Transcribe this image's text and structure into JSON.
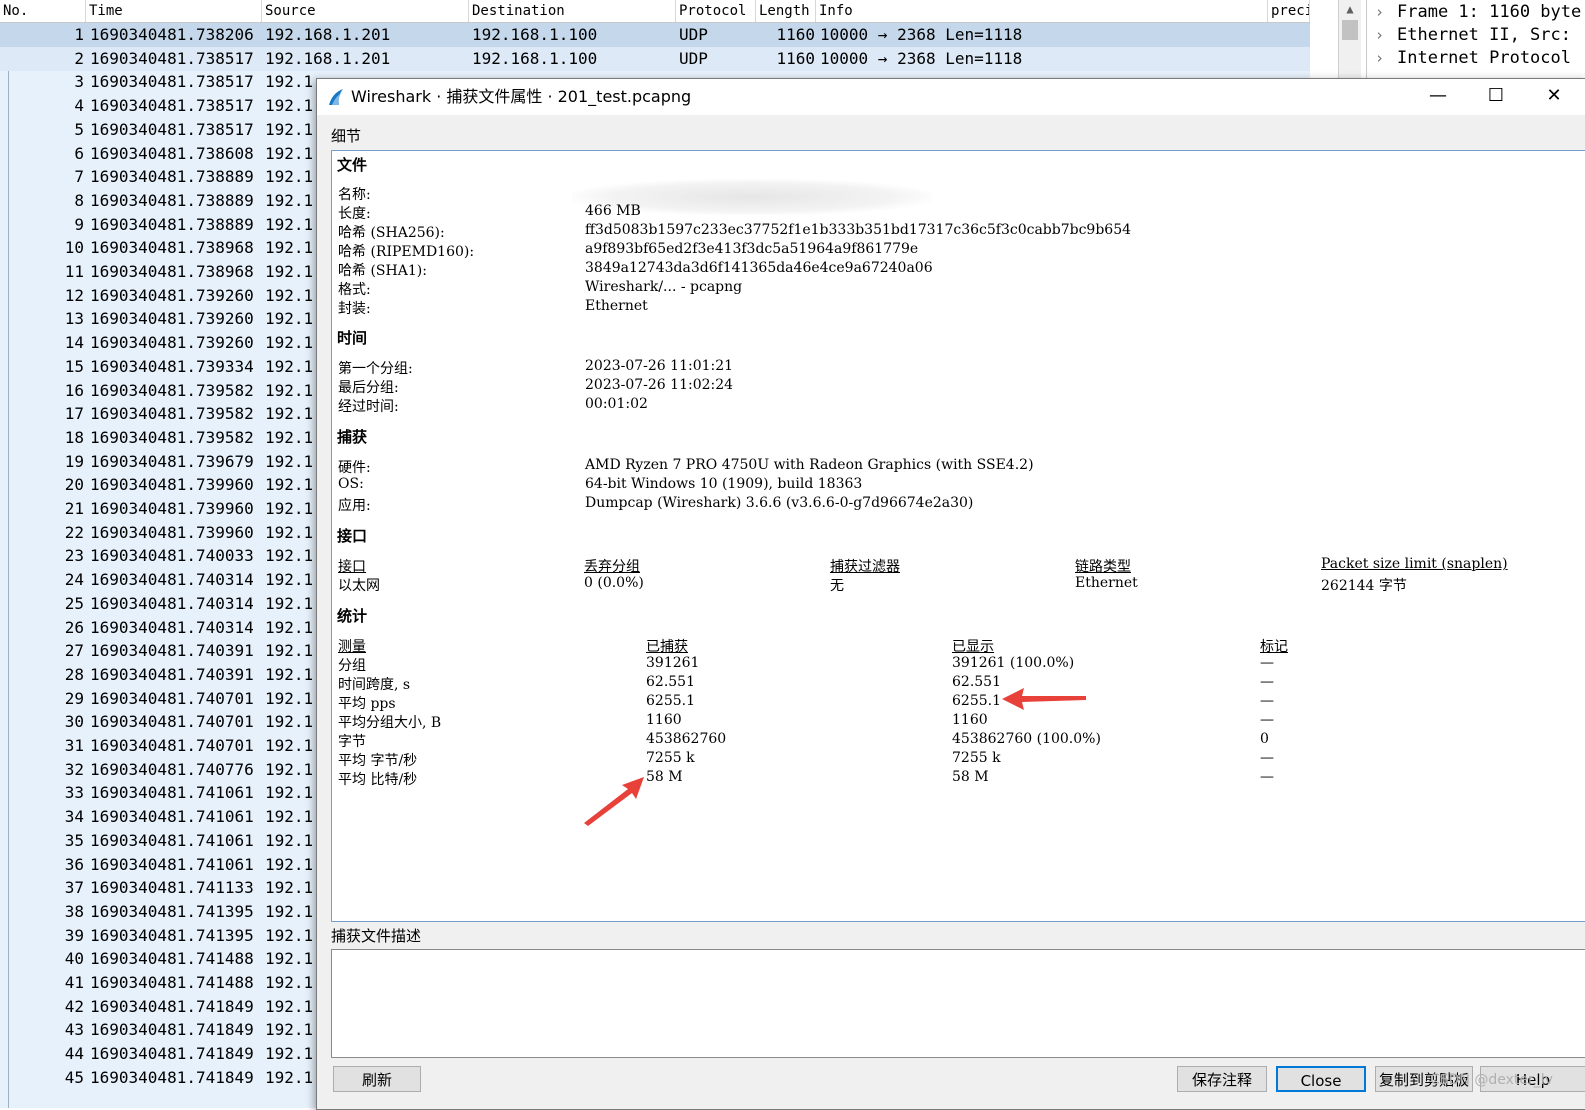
{
  "packet_list": {
    "columns": [
      "No.",
      "Time",
      "Source",
      "Destination",
      "Protocol",
      "Length",
      "Info",
      "preci"
    ],
    "rows": [
      {
        "no": "1",
        "time": "1690340481.738206",
        "src": "192.168.1.201",
        "dst": "192.168.1.100",
        "proto": "UDP",
        "len": "1160",
        "info": "10000 → 2368 Len=1118"
      },
      {
        "no": "2",
        "time": "1690340481.738517",
        "src": "192.168.1.201",
        "dst": "192.168.1.100",
        "proto": "UDP",
        "len": "1160",
        "info": "10000 → 2368 Len=1118"
      },
      {
        "no": "3",
        "time": "1690340481.738517",
        "src": "192.1",
        "dst": "",
        "proto": "",
        "len": "",
        "info": ""
      },
      {
        "no": "4",
        "time": "1690340481.738517",
        "src": "192.1"
      },
      {
        "no": "5",
        "time": "1690340481.738517",
        "src": "192.1"
      },
      {
        "no": "6",
        "time": "1690340481.738608",
        "src": "192.1"
      },
      {
        "no": "7",
        "time": "1690340481.738889",
        "src": "192.1"
      },
      {
        "no": "8",
        "time": "1690340481.738889",
        "src": "192.1"
      },
      {
        "no": "9",
        "time": "1690340481.738889",
        "src": "192.1"
      },
      {
        "no": "10",
        "time": "1690340481.738968",
        "src": "192.1"
      },
      {
        "no": "11",
        "time": "1690340481.738968",
        "src": "192.1"
      },
      {
        "no": "12",
        "time": "1690340481.739260",
        "src": "192.1"
      },
      {
        "no": "13",
        "time": "1690340481.739260",
        "src": "192.1"
      },
      {
        "no": "14",
        "time": "1690340481.739260",
        "src": "192.1"
      },
      {
        "no": "15",
        "time": "1690340481.739334",
        "src": "192.1"
      },
      {
        "no": "16",
        "time": "1690340481.739582",
        "src": "192.1"
      },
      {
        "no": "17",
        "time": "1690340481.739582",
        "src": "192.1"
      },
      {
        "no": "18",
        "time": "1690340481.739582",
        "src": "192.1"
      },
      {
        "no": "19",
        "time": "1690340481.739679",
        "src": "192.1"
      },
      {
        "no": "20",
        "time": "1690340481.739960",
        "src": "192.1"
      },
      {
        "no": "21",
        "time": "1690340481.739960",
        "src": "192.1"
      },
      {
        "no": "22",
        "time": "1690340481.739960",
        "src": "192.1"
      },
      {
        "no": "23",
        "time": "1690340481.740033",
        "src": "192.1"
      },
      {
        "no": "24",
        "time": "1690340481.740314",
        "src": "192.1"
      },
      {
        "no": "25",
        "time": "1690340481.740314",
        "src": "192.1"
      },
      {
        "no": "26",
        "time": "1690340481.740314",
        "src": "192.1"
      },
      {
        "no": "27",
        "time": "1690340481.740391",
        "src": "192.1"
      },
      {
        "no": "28",
        "time": "1690340481.740391",
        "src": "192.1"
      },
      {
        "no": "29",
        "time": "1690340481.740701",
        "src": "192.1"
      },
      {
        "no": "30",
        "time": "1690340481.740701",
        "src": "192.1"
      },
      {
        "no": "31",
        "time": "1690340481.740701",
        "src": "192.1"
      },
      {
        "no": "32",
        "time": "1690340481.740776",
        "src": "192.1"
      },
      {
        "no": "33",
        "time": "1690340481.741061",
        "src": "192.1"
      },
      {
        "no": "34",
        "time": "1690340481.741061",
        "src": "192.1"
      },
      {
        "no": "35",
        "time": "1690340481.741061",
        "src": "192.1"
      },
      {
        "no": "36",
        "time": "1690340481.741061",
        "src": "192.1"
      },
      {
        "no": "37",
        "time": "1690340481.741133",
        "src": "192.1"
      },
      {
        "no": "38",
        "time": "1690340481.741395",
        "src": "192.1"
      },
      {
        "no": "39",
        "time": "1690340481.741395",
        "src": "192.1"
      },
      {
        "no": "40",
        "time": "1690340481.741488",
        "src": "192.1"
      },
      {
        "no": "41",
        "time": "1690340481.741488",
        "src": "192.1"
      },
      {
        "no": "42",
        "time": "1690340481.741849",
        "src": "192.1"
      },
      {
        "no": "43",
        "time": "1690340481.741849",
        "src": "192.1"
      },
      {
        "no": "44",
        "time": "1690340481.741849",
        "src": "192.1"
      },
      {
        "no": "45",
        "time": "1690340481.741849",
        "src": "192.1"
      }
    ]
  },
  "packet_details": [
    "Frame 1: 1160 byte",
    "Ethernet II, Src:",
    "Internet Protocol"
  ],
  "dialog": {
    "title": "Wireshark · 捕获文件属性 · 201_test.pcapng",
    "details_label": "细节",
    "file": {
      "heading": "文件",
      "name_label": "名称:",
      "length_label": "长度:",
      "length": "466 MB",
      "sha256_label": "哈希 (SHA256):",
      "sha256": "ff3d5083b1597c233ec37752f1e1b333b351bd17317c36c5f3c0cabb7bc9b654",
      "ripemd_label": "哈希 (RIPEMD160):",
      "ripemd": "a9f893bf65ed2f3e413f3dc5a51964a9f861779e",
      "sha1_label": "哈希 (SHA1):",
      "sha1": "3849a12743da3d6f141365da46e4ce9a67240a06",
      "format_label": "格式:",
      "format": "Wireshark/... - pcapng",
      "encap_label": "封装:",
      "encap": "Ethernet"
    },
    "time": {
      "heading": "时间",
      "first_label": "第一个分组:",
      "first": "2023-07-26 11:01:21",
      "last_label": "最后分组:",
      "last": "2023-07-26 11:02:24",
      "elapsed_label": "经过时间:",
      "elapsed": "00:01:02"
    },
    "capture": {
      "heading": "捕获",
      "hw_label": "硬件:",
      "hw": "AMD Ryzen 7 PRO 4750U with Radeon Graphics (with SSE4.2)",
      "os_label": "OS:",
      "os": "64-bit Windows 10 (1909), build 18363",
      "app_label": "应用:",
      "app": "Dumpcap (Wireshark) 3.6.6 (v3.6.6-0-g7d96674e2a30)"
    },
    "interfaces": {
      "heading": "接口",
      "headers": [
        "接口",
        "丢弃分组",
        "捕获过滤器",
        "链路类型",
        "Packet size limit (snaplen)"
      ],
      "row": [
        "以太网",
        "0 (0.0%)",
        "无",
        "Ethernet",
        "262144 字节"
      ]
    },
    "stats": {
      "heading": "统计",
      "headers": [
        "测量",
        "已捕获",
        "已显示",
        "标记"
      ],
      "rows": [
        [
          "分组",
          "391261",
          "391261 (100.0%)",
          "—"
        ],
        [
          "时间跨度, s",
          "62.551",
          "62.551",
          "—"
        ],
        [
          "平均 pps",
          "6255.1",
          "6255.1",
          "—"
        ],
        [
          "平均分组大小, B",
          "1160",
          "1160",
          "—"
        ],
        [
          "字节",
          "453862760",
          "453862760 (100.0%)",
          "0"
        ],
        [
          "平均 字节/秒",
          "7255 k",
          "7255 k",
          "—"
        ],
        [
          "平均 比特/秒",
          "58 M",
          "58 M",
          "—"
        ]
      ]
    },
    "desc_label": "捕获文件描述",
    "buttons": {
      "refresh": "刷新",
      "save": "保存注释",
      "close": "Close",
      "copy": "复制到剪贴板",
      "help": "Help"
    }
  },
  "watermark": "CSDN @dexter_lv",
  "colors": {
    "selected_row": "#c5d7ea",
    "arrow": "#e8413a",
    "focus": "#0078d7"
  }
}
